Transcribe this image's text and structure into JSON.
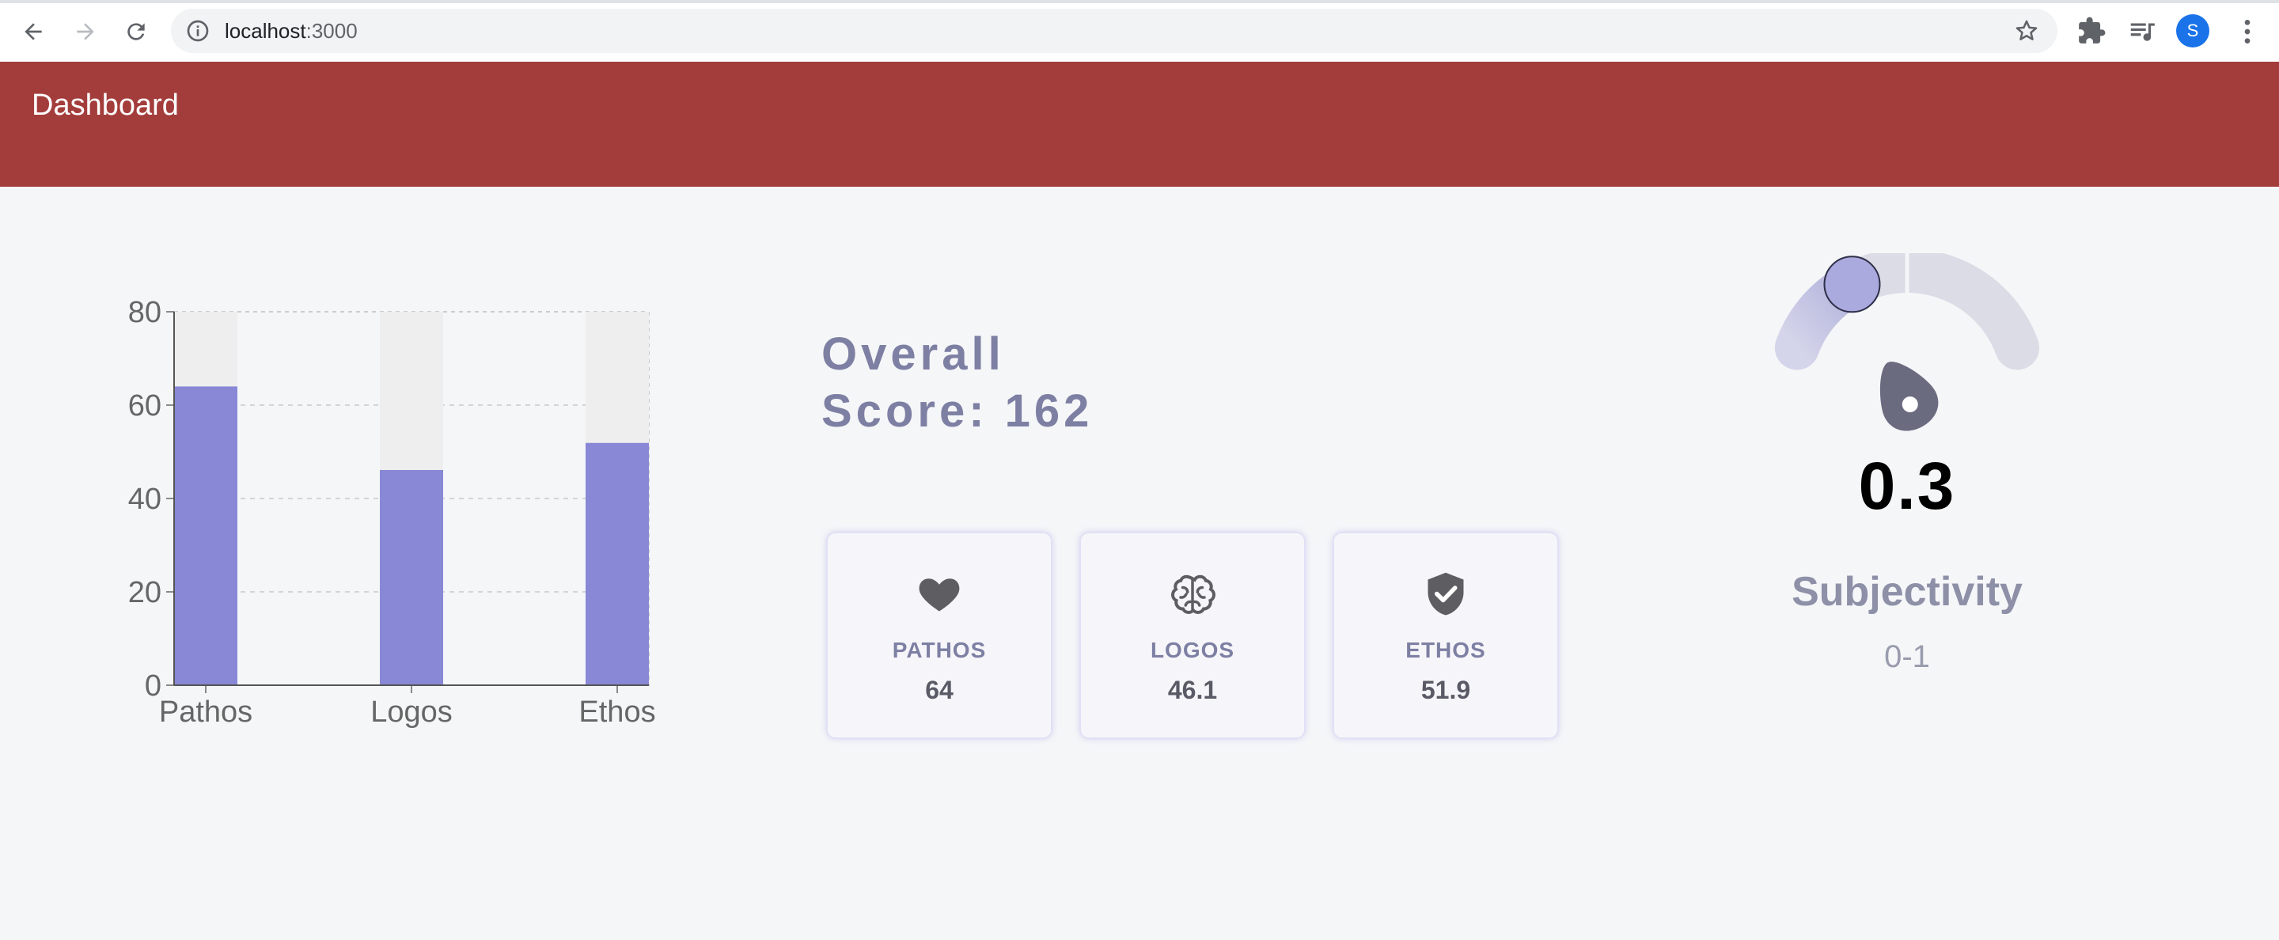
{
  "browser": {
    "url_host": "localhost",
    "url_port": ":3000",
    "profile_initial": "S"
  },
  "header": {
    "title": "Dashboard",
    "color": "#a33d3b"
  },
  "overall": {
    "line1": "Overall",
    "line2": "Score: 162"
  },
  "cards": [
    {
      "icon": "heart-icon",
      "label": "PATHOS",
      "value": "64"
    },
    {
      "icon": "brain-icon",
      "label": "LOGOS",
      "value": "46.1"
    },
    {
      "icon": "shield-check-icon",
      "label": "ETHOS",
      "value": "51.9"
    }
  ],
  "gauge": {
    "value": 0.3,
    "value_label": "0.3",
    "label": "Subjectivity",
    "range_label": "0-1"
  },
  "chart_data": {
    "type": "bar",
    "categories": [
      "Pathos",
      "Logos",
      "Ethos"
    ],
    "values": [
      64,
      46.1,
      51.9
    ],
    "ylim": [
      0,
      80
    ],
    "yticks": [
      0,
      20,
      40,
      60,
      80
    ],
    "grid": true,
    "bar_color": "#8888d6",
    "background_bar_color": "#eeeeee"
  }
}
